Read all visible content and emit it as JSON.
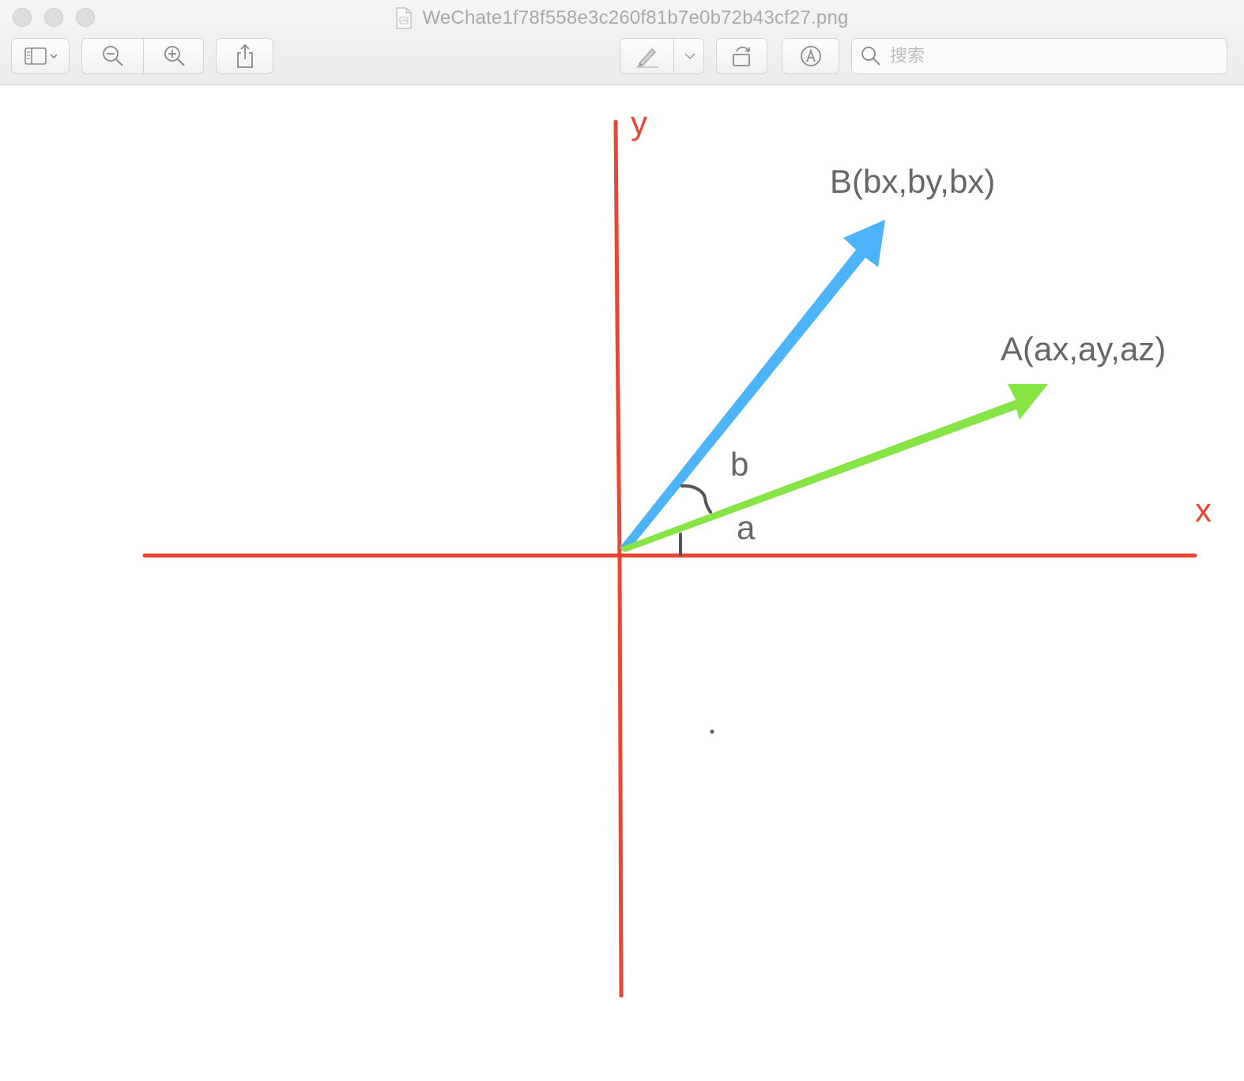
{
  "window": {
    "title": "WeChate1f78f558e3c260f81b7e0b72b43cf27.png"
  },
  "toolbar": {
    "sidebar_icon": "sidebar-icon",
    "zoom_out_icon": "zoom-out-icon",
    "zoom_in_icon": "zoom-in-icon",
    "share_icon": "share-icon",
    "markup_icon": "pen-icon",
    "rotate_icon": "rotate-icon",
    "annotate_icon": "markup-circle-icon"
  },
  "search": {
    "placeholder": "搜索"
  },
  "diagram": {
    "y_label": "y",
    "x_label": "x",
    "vector_b_label": "B(bx,by,bx)",
    "vector_a_label": "A(ax,ay,az)",
    "angle_b_label": "b",
    "angle_a_label": "a",
    "colors": {
      "axis": "#ee4433",
      "vector_a": "#86e445",
      "vector_b": "#4db3fa",
      "text": "#666666",
      "mark": "#555555"
    }
  }
}
